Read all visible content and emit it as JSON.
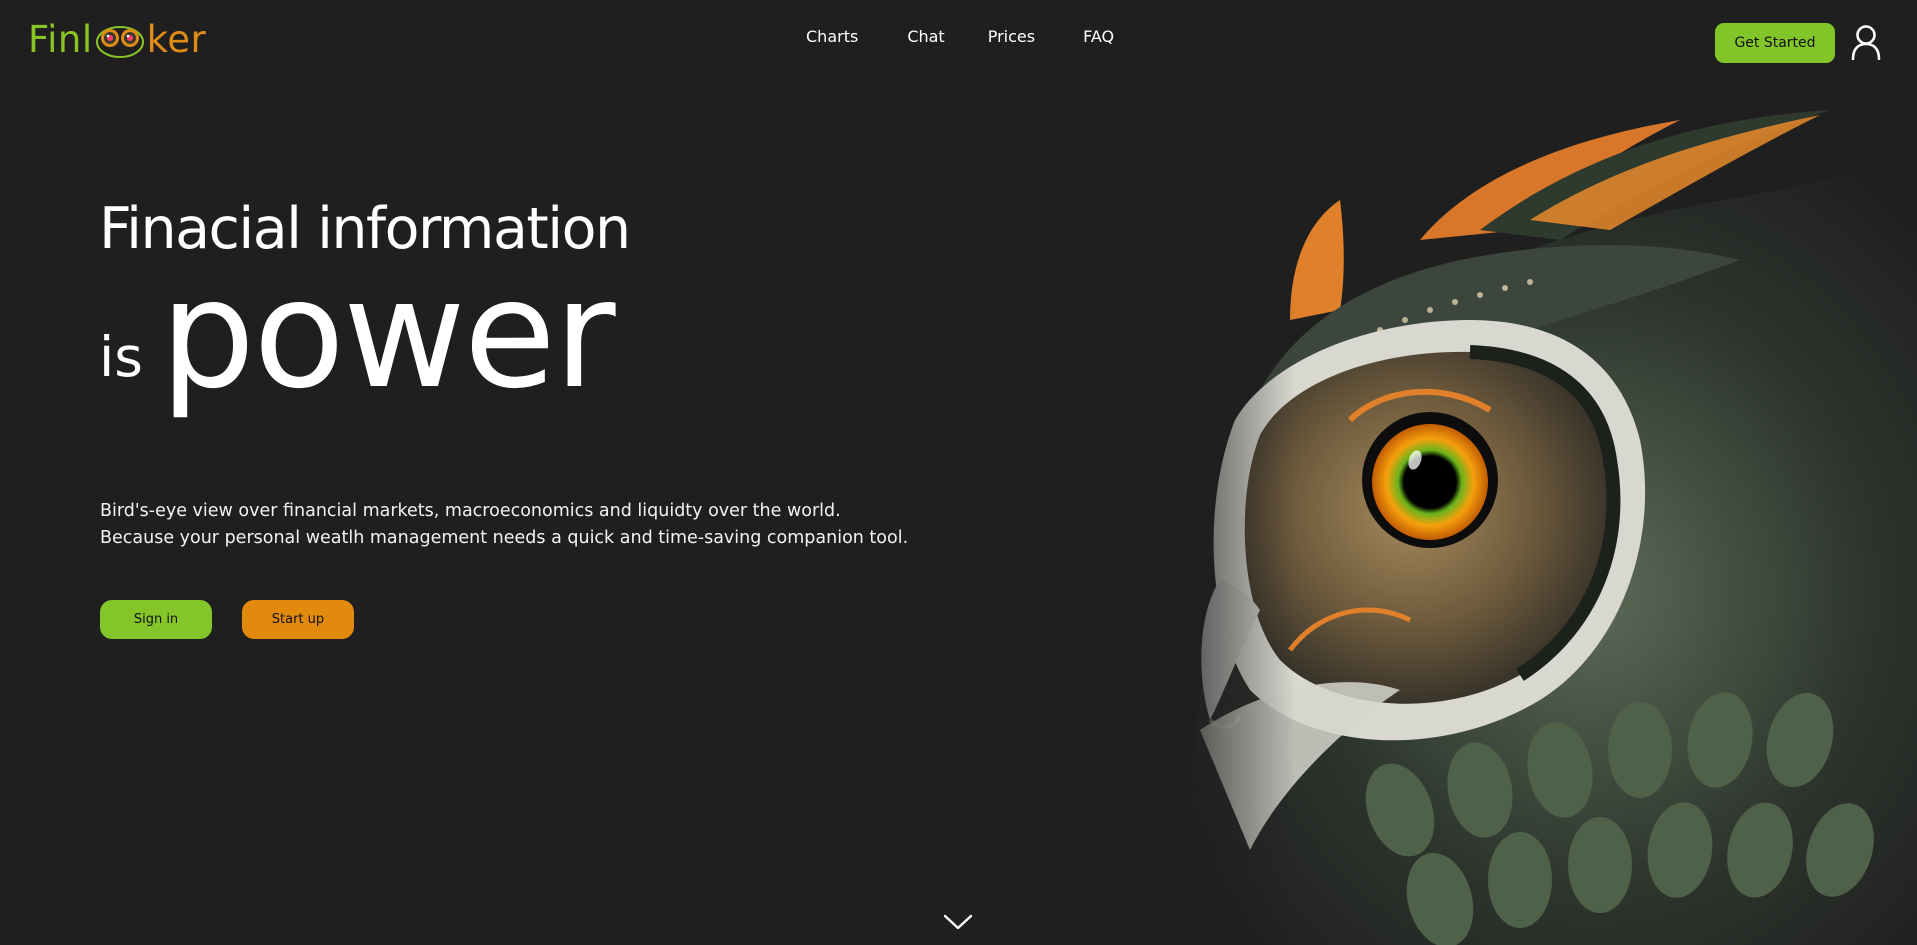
{
  "brand": {
    "name_left": "Finl",
    "name_right": "ker",
    "colors": {
      "green": "#84c52a",
      "orange": "#e28a0d",
      "background": "#201f20"
    }
  },
  "nav": {
    "items": [
      {
        "label": "Charts"
      },
      {
        "label": "Chat"
      },
      {
        "label": "Prices"
      },
      {
        "label": "FAQ"
      }
    ]
  },
  "header": {
    "cta_label": "Get Started",
    "user_icon": "user-icon"
  },
  "hero": {
    "headline": "Finacial information",
    "is_word": "is",
    "power_word": "power",
    "description_line1": "Bird's-eye view over financial markets, macroeconomics and liquidty over the world.",
    "description_line2": "Because your personal weatlh management needs a quick and time-saving companion tool.",
    "signin_label": "Sign in",
    "startup_label": "Start up",
    "scroll_icon": "chevron-down-icon"
  }
}
